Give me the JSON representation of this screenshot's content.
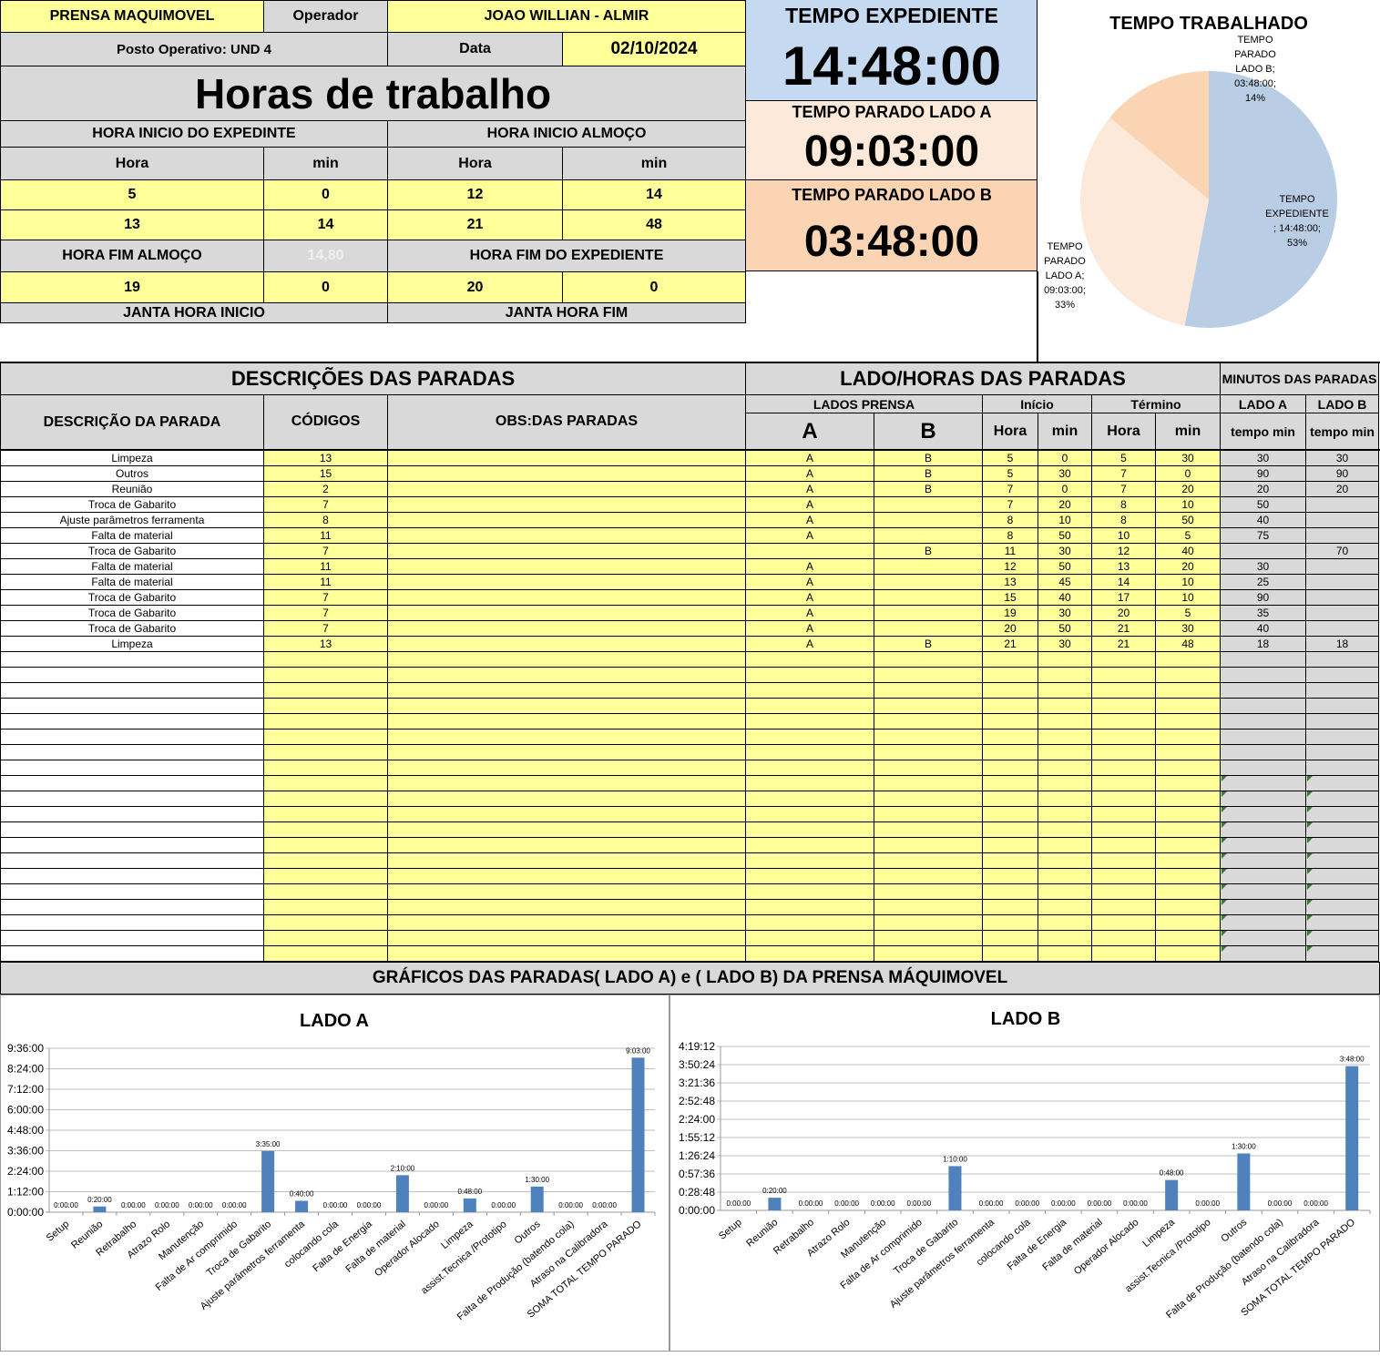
{
  "header": {
    "machine": "PRENSA MAQUIMOVEL",
    "operator_label": "Operador",
    "operator": "JOAO WILLIAN - ALMIR",
    "post": "Posto Operativo: UND 4",
    "date_label": "Data",
    "date": "02/10/2024",
    "title": "Horas de trabalho"
  },
  "schedule": {
    "start_label": "HORA INICIO DO EXPEDINTE",
    "lunch_start_label": "HORA INICIO ALMOÇO",
    "hora": "Hora",
    "min": "min",
    "start_h": "5",
    "start_m": "0",
    "lunch_h": "12",
    "lunch_m": "14",
    "r2a": "13",
    "r2b": "14",
    "r2c": "21",
    "r2d": "48",
    "lunch_end_label": "HORA FIM ALMOÇO",
    "faded": "14,80",
    "end_label": "HORA FIM DO EXPEDIENTE",
    "lunch_end_h": "19",
    "lunch_end_m": "0",
    "end_h": "20",
    "end_m": "0",
    "dinner_start": "JANTA HORA INICIO",
    "dinner_end": "JANTA HORA FIM"
  },
  "totals": {
    "expediente_label": "TEMPO EXPEDIENTE",
    "expediente": "14:48:00",
    "lado_a_label": "TEMPO PARADO LADO A",
    "lado_a": "09:03:00",
    "lado_b_label": "TEMPO PARADO LADO B",
    "lado_b": "03:48:00"
  },
  "pie": {
    "title": "TEMPO TRABALHADO",
    "colors": [
      "#b9cde5",
      "#fde9d9",
      "#fbd4b4"
    ],
    "labels": {
      "b": [
        "TEMPO",
        "PARADO",
        "LADO B;",
        "03:48:00;",
        "14%"
      ],
      "exp": [
        "TEMPO",
        "EXPEDIENTE",
        "; 14:48:00;",
        "53%"
      ],
      "a": [
        "TEMPO",
        "PARADO",
        "LADO A;",
        "09:03:00;",
        "33%"
      ]
    }
  },
  "stops": {
    "desc_title": "DESCRIÇÕES DAS PARADAS",
    "lado_title": "LADO/HORAS DAS PARADAS",
    "min_title": "MINUTOS DAS PARADAS",
    "col_desc": "DESCRIÇÃO DA PARADA",
    "col_codes": "CÓDIGOS",
    "col_obs": "OBS:DAS PARADAS",
    "lados_prensa": "LADOS PRENSA",
    "inicio": "Início",
    "termino": "Término",
    "lado_a": "LADO A",
    "lado_b": "LADO B",
    "a": "A",
    "b": "B",
    "hora": "Hora",
    "min": "min",
    "tempo_min": "tempo min",
    "rows": [
      [
        "Limpeza",
        "13",
        "",
        "A",
        "B",
        "5",
        "0",
        "5",
        "30",
        "30",
        "30"
      ],
      [
        "Outros",
        "15",
        "",
        "A",
        "B",
        "5",
        "30",
        "7",
        "0",
        "90",
        "90"
      ],
      [
        "Reunião",
        "2",
        "",
        "A",
        "B",
        "7",
        "0",
        "7",
        "20",
        "20",
        "20"
      ],
      [
        "Troca de Gabarito",
        "7",
        "",
        "A",
        "",
        "7",
        "20",
        "8",
        "10",
        "50",
        ""
      ],
      [
        "Ajuste parâmetros ferramenta",
        "8",
        "",
        "A",
        "",
        "8",
        "10",
        "8",
        "50",
        "40",
        ""
      ],
      [
        "Falta de material",
        "11",
        "",
        "A",
        "",
        "8",
        "50",
        "10",
        "5",
        "75",
        ""
      ],
      [
        "Troca de Gabarito",
        "7",
        "",
        "",
        "B",
        "11",
        "30",
        "12",
        "40",
        "",
        "70"
      ],
      [
        "Falta de material",
        "11",
        "",
        "A",
        "",
        "12",
        "50",
        "13",
        "20",
        "30",
        ""
      ],
      [
        "Falta de material",
        "11",
        "",
        "A",
        "",
        "13",
        "45",
        "14",
        "10",
        "25",
        ""
      ],
      [
        "Troca de Gabarito",
        "7",
        "",
        "A",
        "",
        "15",
        "40",
        "17",
        "10",
        "90",
        ""
      ],
      [
        "Troca de Gabarito",
        "7",
        "",
        "A",
        "",
        "19",
        "30",
        "20",
        "5",
        "35",
        ""
      ],
      [
        "Troca de Gabarito",
        "7",
        "",
        "A",
        "",
        "20",
        "50",
        "21",
        "30",
        "40",
        ""
      ],
      [
        "Limpeza",
        "13",
        "",
        "A",
        "B",
        "21",
        "30",
        "21",
        "48",
        "18",
        "18"
      ]
    ]
  },
  "charts_banner": "GRÁFICOS DAS PARADAS( LADO A) e ( LADO B) DA PRENSA MÁQUIMOVEL",
  "chart_data": [
    {
      "type": "bar",
      "title": "LADO A",
      "color": "#4f81bd",
      "yticks": [
        "0:00:00",
        "1:12:00",
        "2:24:00",
        "3:36:00",
        "4:48:00",
        "6:00:00",
        "7:12:00",
        "8:24:00",
        "9:36:00"
      ],
      "ylim": [
        0,
        576
      ],
      "categories": [
        "Setup",
        "Reunião",
        "Retrabalho",
        "Atrazo Rolo",
        "Manutenção",
        "Falta de Ar comprimido",
        "Troca de Gabarito",
        "Ajuste parâmetros ferramenta",
        "colocando cola",
        "Falta de Energia",
        "Falta de material",
        "Operador Alocado",
        "Limpeza",
        "assist.Tecnica /Prototipo",
        "Outros",
        "Falta de Produção (batendo cola)",
        "Atraso na Calibradora",
        "SOMA TOTAL TEMPO PARADO"
      ],
      "values": [
        0,
        20,
        0,
        0,
        0,
        0,
        215,
        40,
        0,
        0,
        130,
        0,
        48,
        0,
        90,
        0,
        0,
        543
      ],
      "labels": [
        "0:00:00",
        "0:20:00",
        "0:00:00",
        "0:00:00",
        "0:00:00",
        "0:00:00",
        "3:35:00",
        "0:40:00",
        "0:00:00",
        "0:00:00",
        "2:10:00",
        "0:00:00",
        "0:48:00",
        "0:00:00",
        "1:30:00",
        "0:00:00",
        "0:00:00",
        "9:03:00"
      ]
    },
    {
      "type": "bar",
      "title": "LADO B",
      "color": "#4f81bd",
      "yticks": [
        "0:00:00",
        "0:28:48",
        "0:57:36",
        "1:26:24",
        "1:55:12",
        "2:24:00",
        "2:52:48",
        "3:21:36",
        "3:50:24",
        "4:19:12"
      ],
      "ylim": [
        0,
        259.2
      ],
      "categories": [
        "Setup",
        "Reunião",
        "Retrabalho",
        "Atrazo Rolo",
        "Manutenção",
        "Falta de Ar comprimido",
        "Troca de Gabarito",
        "Ajuste parâmetros ferramenta",
        "colocando cola",
        "Falta de Energia",
        "Falta de material",
        "Operador Alocado",
        "Limpeza",
        "assist.Tecnica /Prototipo",
        "Outros",
        "Falta de Produção (batendo cola)",
        "Atraso na Calibradora",
        "SOMA TOTAL TEMPO PARADO"
      ],
      "values": [
        0,
        20,
        0,
        0,
        0,
        0,
        70,
        0,
        0,
        0,
        0,
        0,
        48,
        0,
        90,
        0,
        0,
        228
      ],
      "labels": [
        "0:00:00",
        "0:20:00",
        "0:00:00",
        "0:00:00",
        "0:00:00",
        "0:00:00",
        "1:10:00",
        "0:00:00",
        "0:00:00",
        "0:00:00",
        "0:00:00",
        "0:00:00",
        "0:48:00",
        "0:00:00",
        "1:30:00",
        "0:00:00",
        "0:00:00",
        "3:48:00"
      ]
    }
  ]
}
